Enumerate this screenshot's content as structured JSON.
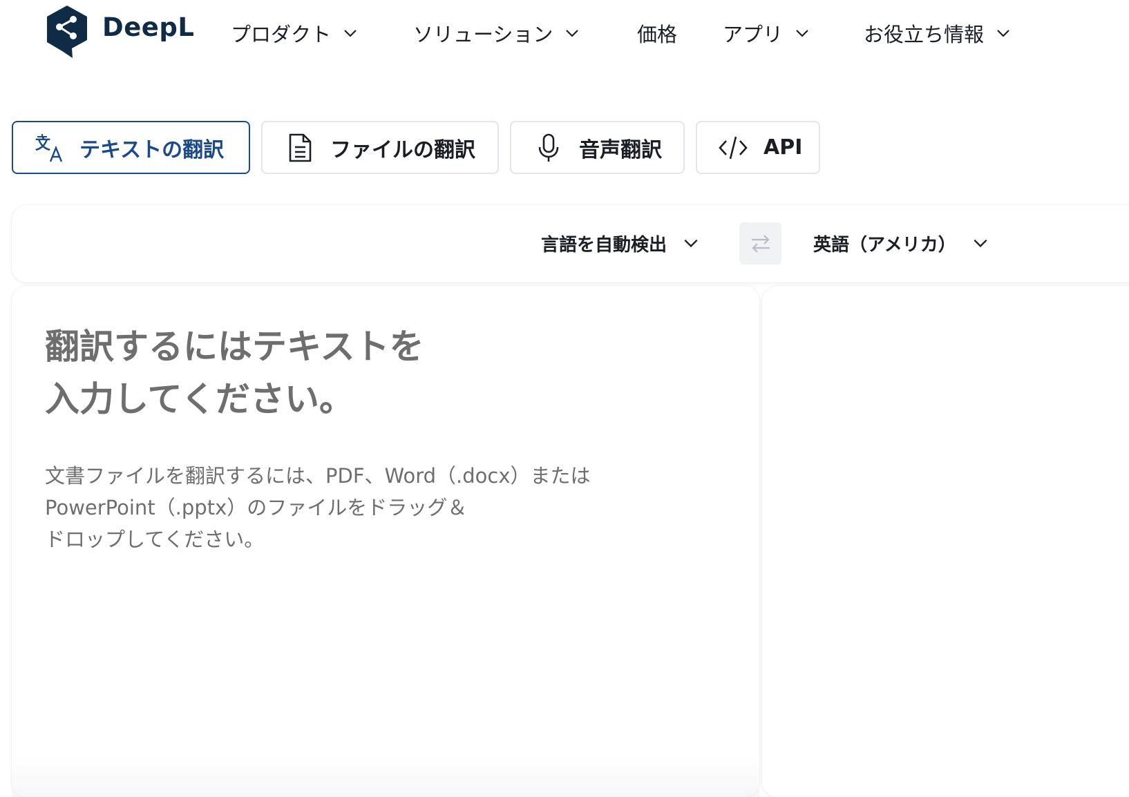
{
  "brand": {
    "name": "DeepL",
    "color": "#0f2b46"
  },
  "nav": {
    "items": [
      {
        "label": "プロダクト",
        "has_dropdown": true
      },
      {
        "label": "ソリューション",
        "has_dropdown": true
      },
      {
        "label": "価格",
        "has_dropdown": false
      },
      {
        "label": "アプリ",
        "has_dropdown": true
      },
      {
        "label": "お役立ち情報",
        "has_dropdown": true
      }
    ]
  },
  "tabs": [
    {
      "label": "テキストの翻訳",
      "icon": "translate-icon",
      "active": true
    },
    {
      "label": "ファイルの翻訳",
      "icon": "document-icon",
      "active": false
    },
    {
      "label": "音声翻訳",
      "icon": "microphone-icon",
      "active": false
    },
    {
      "label": "API",
      "icon": "code-icon",
      "active": false
    }
  ],
  "language_bar": {
    "source_language": "言語を自動検出",
    "target_language": "英語（アメリカ）",
    "swap_icon": "swap-arrows-icon"
  },
  "source_pane": {
    "placeholder_line1": "翻訳するにはテキストを",
    "placeholder_line2": "入力してください。",
    "hint_line1": "文書ファイルを翻訳するには、PDF、Word（.docx）または",
    "hint_line2": "PowerPoint（.pptx）のファイルをドラッグ＆",
    "hint_line3": "ドロップしてください。"
  },
  "colors": {
    "accent": "#1a4a8b",
    "text": "#1b1e25",
    "placeholder": "#6e6e6e",
    "swap_bg": "#f1f2f4"
  }
}
